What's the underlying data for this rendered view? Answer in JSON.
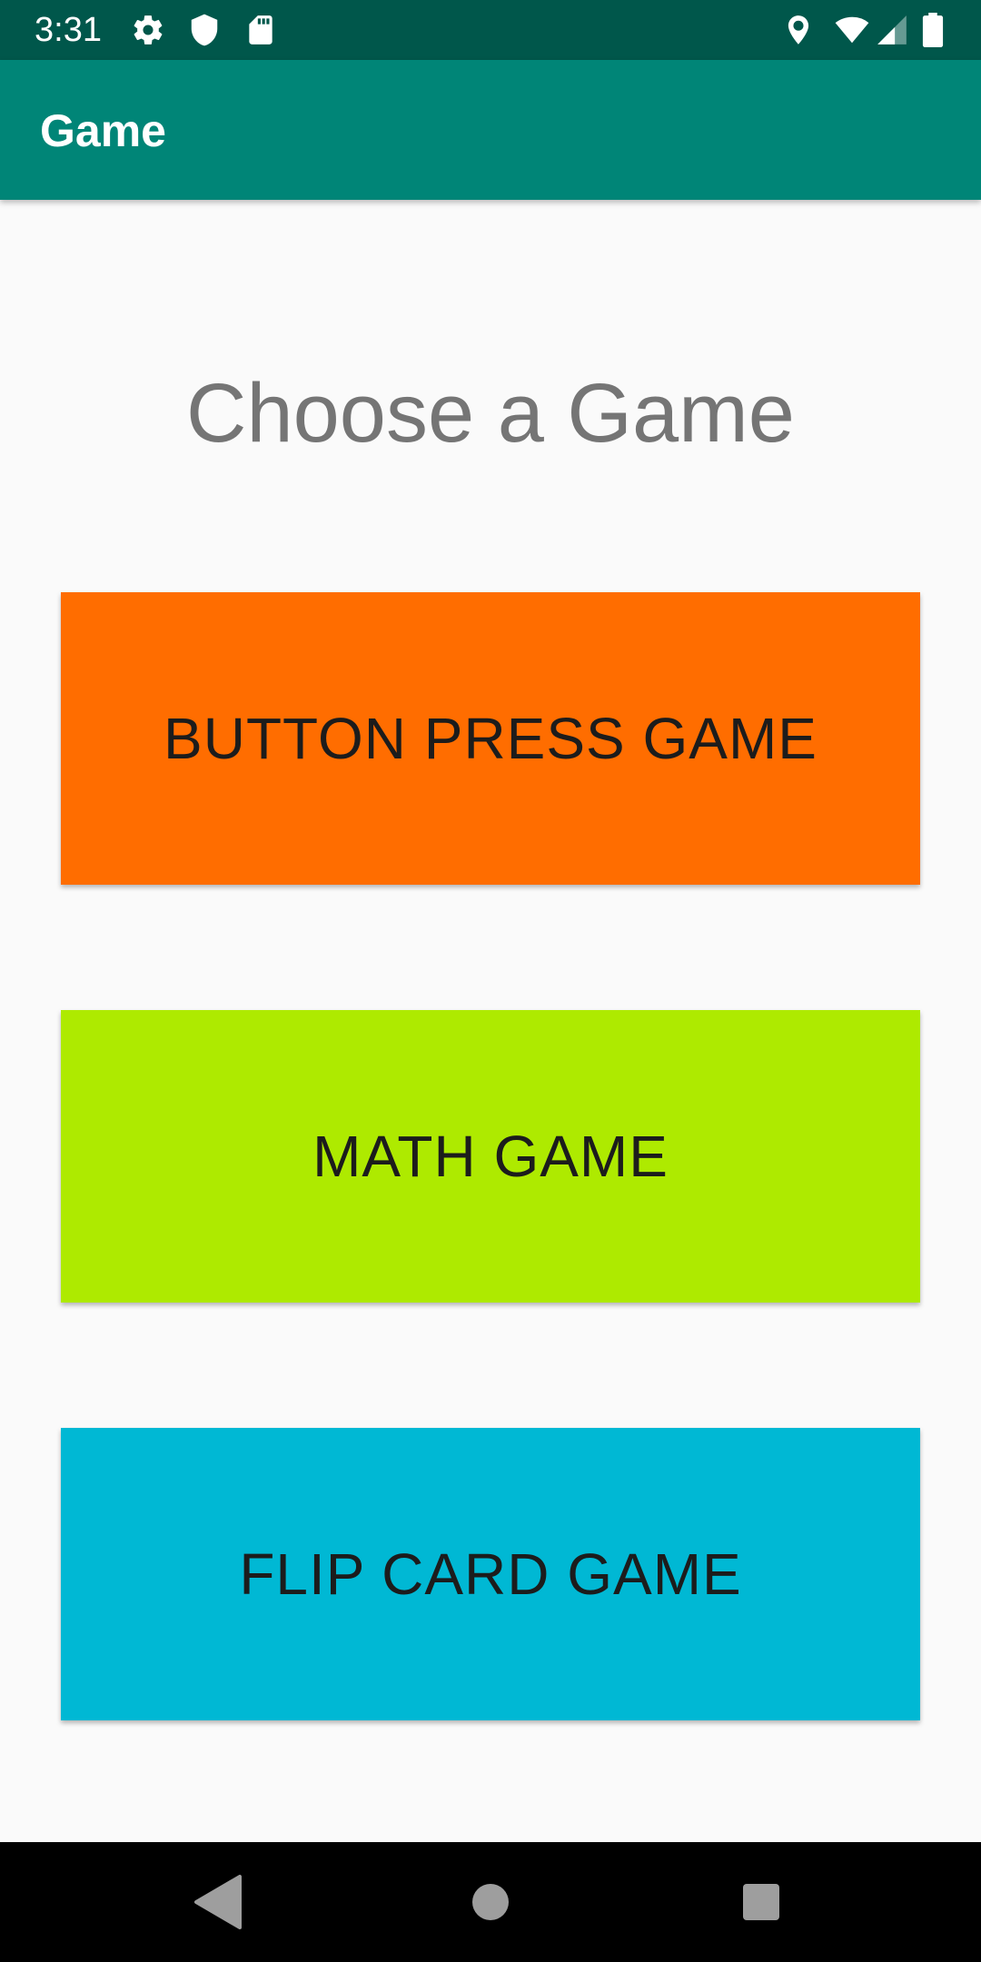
{
  "status_bar": {
    "time": "3:31",
    "left_icons": [
      "settings-icon",
      "shield-icon",
      "sd-card-icon"
    ],
    "right_icons": [
      "location-icon",
      "wifi-icon",
      "cell-signal-icon",
      "battery-icon"
    ]
  },
  "app_bar": {
    "title": "Game"
  },
  "main": {
    "heading": "Choose a Game",
    "buttons": [
      {
        "label": "BUTTON PRESS GAME",
        "color": "#ff6d00"
      },
      {
        "label": "MATH GAME",
        "color": "#aeea00"
      },
      {
        "label": "FLIP CARD GAME",
        "color": "#00b8d4"
      }
    ]
  },
  "nav_bar": {
    "icons": [
      "back-icon",
      "home-icon",
      "recents-icon"
    ]
  },
  "colors": {
    "status_bar": "#00574b",
    "app_bar": "#008577",
    "background": "#fafafa",
    "nav_bar": "#000000"
  }
}
